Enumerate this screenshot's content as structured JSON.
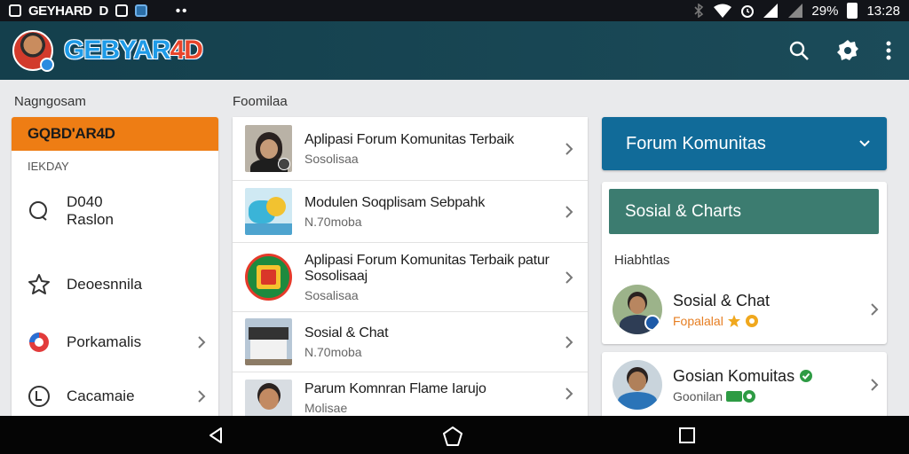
{
  "status_bar": {
    "app_name": "GEYHARD",
    "letter": "D",
    "dots": "••",
    "battery": "29%",
    "time": "13:28"
  },
  "app_bar": {
    "logo_main": "GEBYAR",
    "logo_accent": "4D",
    "icons": [
      "search-icon",
      "settings-icon",
      "more-vert-icon"
    ]
  },
  "left_panel": {
    "section_label": "Nagngosam",
    "header": "GQBD'AR4D",
    "subheader": "IEKDAY",
    "items": [
      {
        "label_line1": "D040",
        "label_line2": "Raslon",
        "icon": "chat-bubble-icon"
      },
      {
        "label": "Deoesnnila",
        "icon": "puzzle-icon"
      },
      {
        "label": "Porkamalis",
        "icon": "pie-icon"
      },
      {
        "label": "Cacamaie",
        "icon": "timer-icon"
      }
    ]
  },
  "middle_panel": {
    "section_label": "Foomilaa",
    "rows": [
      {
        "title": "Aplipasi Forum Komunitas Terbaik",
        "subtitle": "Sosolisaa"
      },
      {
        "title": "Modulen Soqplisam Sebpahk",
        "subtitle": "N.70moba"
      },
      {
        "title_line1": "Aplipasi Forum Komunitas Terbaik patur",
        "title_line2": "Sosolisaaj",
        "subtitle": "Sosalisaa"
      },
      {
        "title": "Sosial & Chat",
        "subtitle": "N.70moba"
      },
      {
        "title": "Parum Komnran Flame Iarujo",
        "subtitle": "Molisae"
      }
    ]
  },
  "right_panel": {
    "header": "Forum Komunitas",
    "chip": "Sosial & Charts",
    "caption": "Hiabhtlas",
    "people": [
      {
        "name": "Sosial & Chat",
        "meta": "Fopalalal",
        "meta_color": "#e67e22"
      },
      {
        "name": "Gosian Komuitas",
        "meta": "Goonilan",
        "meta_color": "#555555"
      }
    ]
  },
  "colors": {
    "app_bar": "#143f4c",
    "drawer_header": "#ee7d14",
    "forum_header": "#116b99",
    "chip": "#3c7c70"
  }
}
